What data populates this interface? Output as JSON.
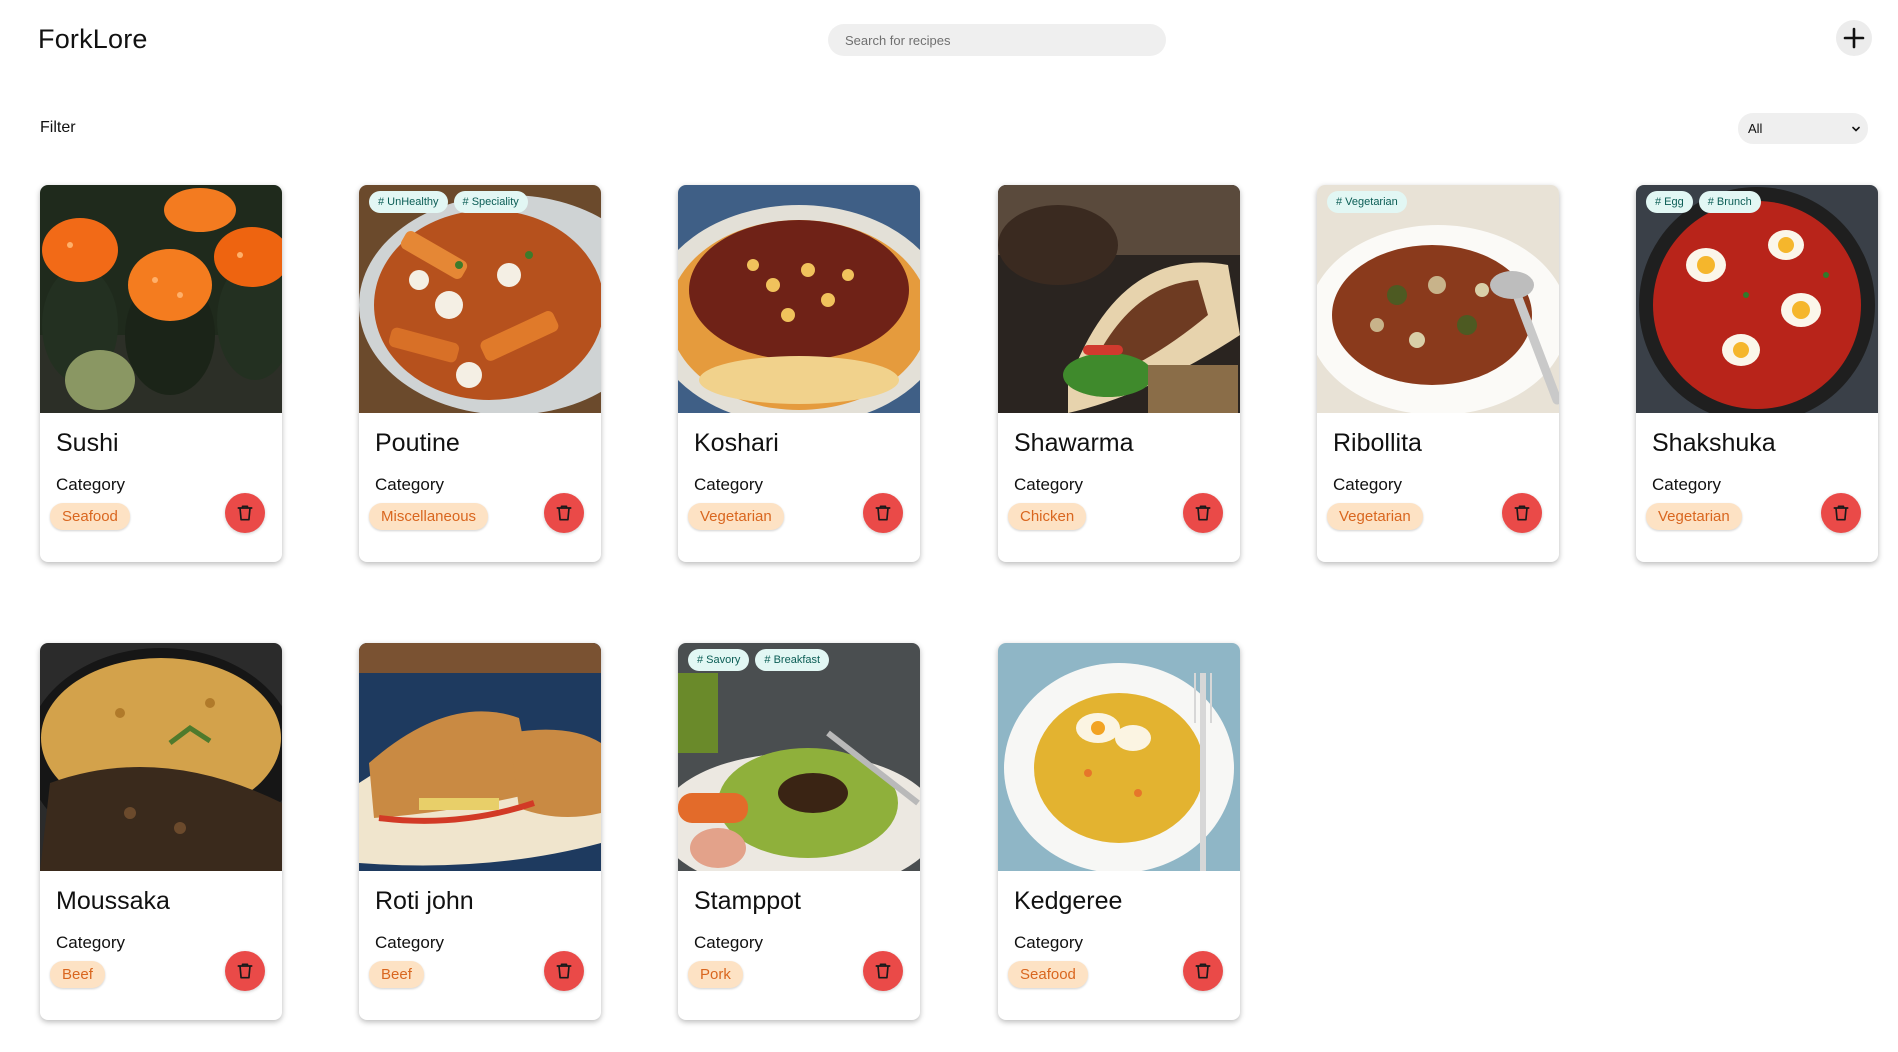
{
  "app": {
    "title": "ForkLore"
  },
  "search": {
    "placeholder": "Search for recipes",
    "value": ""
  },
  "filter": {
    "label": "Filter",
    "selected": "All"
  },
  "category_label": "Category",
  "colors": {
    "delete_button": "#ea4a48",
    "category_badge_bg": "#fde2c4",
    "category_badge_text": "#d9661f",
    "tag_bg": "#e2f7f4",
    "tag_text": "#0b5d55"
  },
  "recipes": [
    {
      "name": "Sushi",
      "category": "Seafood",
      "tags": []
    },
    {
      "name": "Poutine",
      "category": "Miscellaneous",
      "tags": [
        "# UnHealthy",
        "# Speciality"
      ]
    },
    {
      "name": "Koshari",
      "category": "Vegetarian",
      "tags": []
    },
    {
      "name": "Shawarma",
      "category": "Chicken",
      "tags": []
    },
    {
      "name": "Ribollita",
      "category": "Vegetarian",
      "tags": [
        "# Vegetarian"
      ]
    },
    {
      "name": "Shakshuka",
      "category": "Vegetarian",
      "tags": [
        "# Egg",
        "# Brunch"
      ]
    },
    {
      "name": "Moussaka",
      "category": "Beef",
      "tags": []
    },
    {
      "name": "Roti john",
      "category": "Beef",
      "tags": []
    },
    {
      "name": "Stamppot",
      "category": "Pork",
      "tags": [
        "# Savory",
        "# Breakfast"
      ]
    },
    {
      "name": "Kedgeree",
      "category": "Seafood",
      "tags": []
    }
  ]
}
